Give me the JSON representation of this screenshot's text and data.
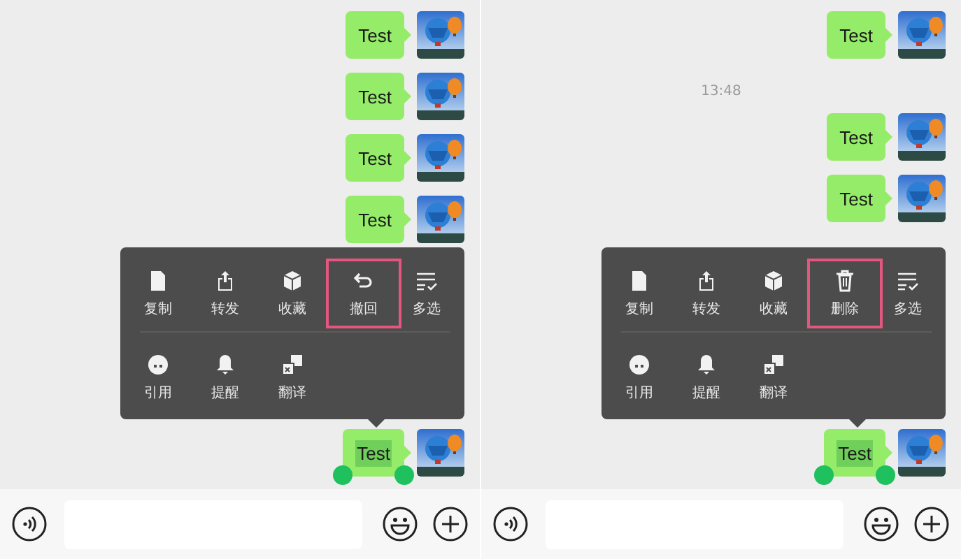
{
  "panels": [
    {
      "messages": [
        {
          "kind": "message",
          "text": "Test",
          "selected": false
        },
        {
          "kind": "message",
          "text": "Test",
          "selected": false
        },
        {
          "kind": "message",
          "text": "Test",
          "selected": false
        },
        {
          "kind": "message",
          "text": "Test",
          "selected": false
        },
        {
          "kind": "message",
          "text": "Test",
          "selected": true
        }
      ],
      "menu": {
        "items": [
          {
            "kind": "copy",
            "label": "复制",
            "highlighted": false
          },
          {
            "kind": "forward",
            "label": "转发",
            "highlighted": false
          },
          {
            "kind": "favorite",
            "label": "收藏",
            "highlighted": false
          },
          {
            "kind": "recall",
            "label": "撤回",
            "highlighted": true
          },
          {
            "kind": "multi",
            "label": "多选",
            "highlighted": false
          },
          {
            "kind": "quote",
            "label": "引用",
            "highlighted": false
          },
          {
            "kind": "remind",
            "label": "提醒",
            "highlighted": false
          },
          {
            "kind": "translate",
            "label": "翻译",
            "highlighted": false
          }
        ]
      }
    },
    {
      "messages": [
        {
          "kind": "message",
          "text": "Test",
          "selected": false
        },
        {
          "kind": "time",
          "text": "13:48"
        },
        {
          "kind": "message",
          "text": "Test",
          "selected": false
        },
        {
          "kind": "message",
          "text": "Test",
          "selected": false
        },
        {
          "kind": "message",
          "text": "Test",
          "selected": true
        }
      ],
      "menu": {
        "items": [
          {
            "kind": "copy",
            "label": "复制",
            "highlighted": false
          },
          {
            "kind": "forward",
            "label": "转发",
            "highlighted": false
          },
          {
            "kind": "favorite",
            "label": "收藏",
            "highlighted": false
          },
          {
            "kind": "delete",
            "label": "删除",
            "highlighted": true
          },
          {
            "kind": "multi",
            "label": "多选",
            "highlighted": false
          },
          {
            "kind": "quote",
            "label": "引用",
            "highlighted": false
          },
          {
            "kind": "remind",
            "label": "提醒",
            "highlighted": false
          },
          {
            "kind": "translate",
            "label": "翻译",
            "highlighted": false
          }
        ]
      }
    }
  ]
}
